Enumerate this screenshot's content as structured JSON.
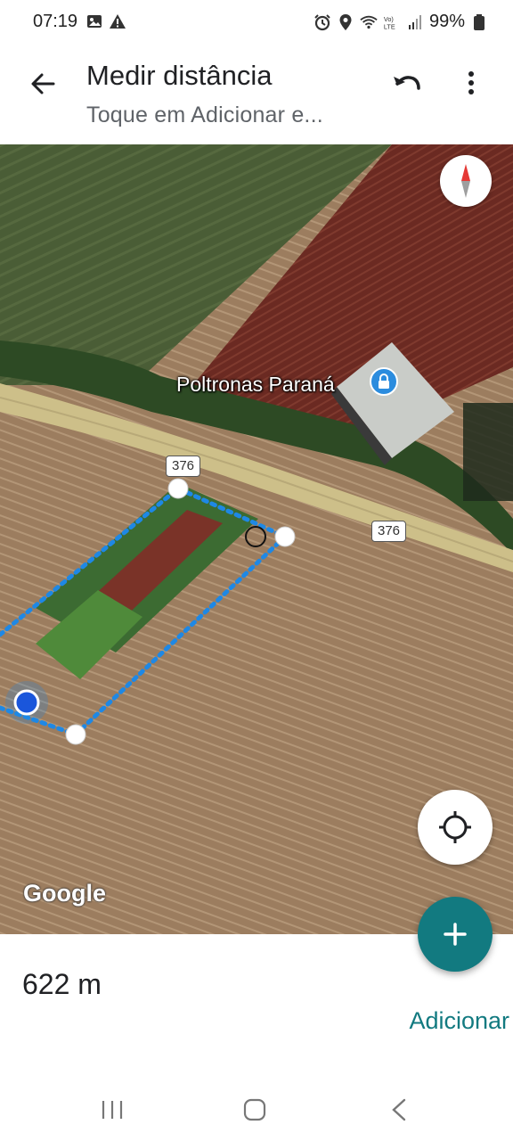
{
  "status_bar": {
    "time": "07:19",
    "battery": "99%",
    "icons": [
      "image-icon",
      "warning-icon",
      "alarm-icon",
      "location-icon",
      "wifi-icon",
      "volte-icon",
      "signal-icon",
      "battery-icon"
    ]
  },
  "app_bar": {
    "title": "Medir distância",
    "subtitle": "Toque em Adicionar e...",
    "back_icon": "arrow-back-icon",
    "undo_icon": "undo-icon",
    "more_icon": "more-vert-icon"
  },
  "map": {
    "place_label": "Poltronas Paraná",
    "road_shields": [
      "376",
      "376"
    ],
    "attribution": "Google",
    "measure_color": "#1e88e5",
    "accent": "#127a80"
  },
  "bottom": {
    "distance": "622 m",
    "add_label": "Adicionar"
  },
  "nav": {
    "icons": [
      "recents-icon",
      "home-icon",
      "back-icon"
    ]
  }
}
